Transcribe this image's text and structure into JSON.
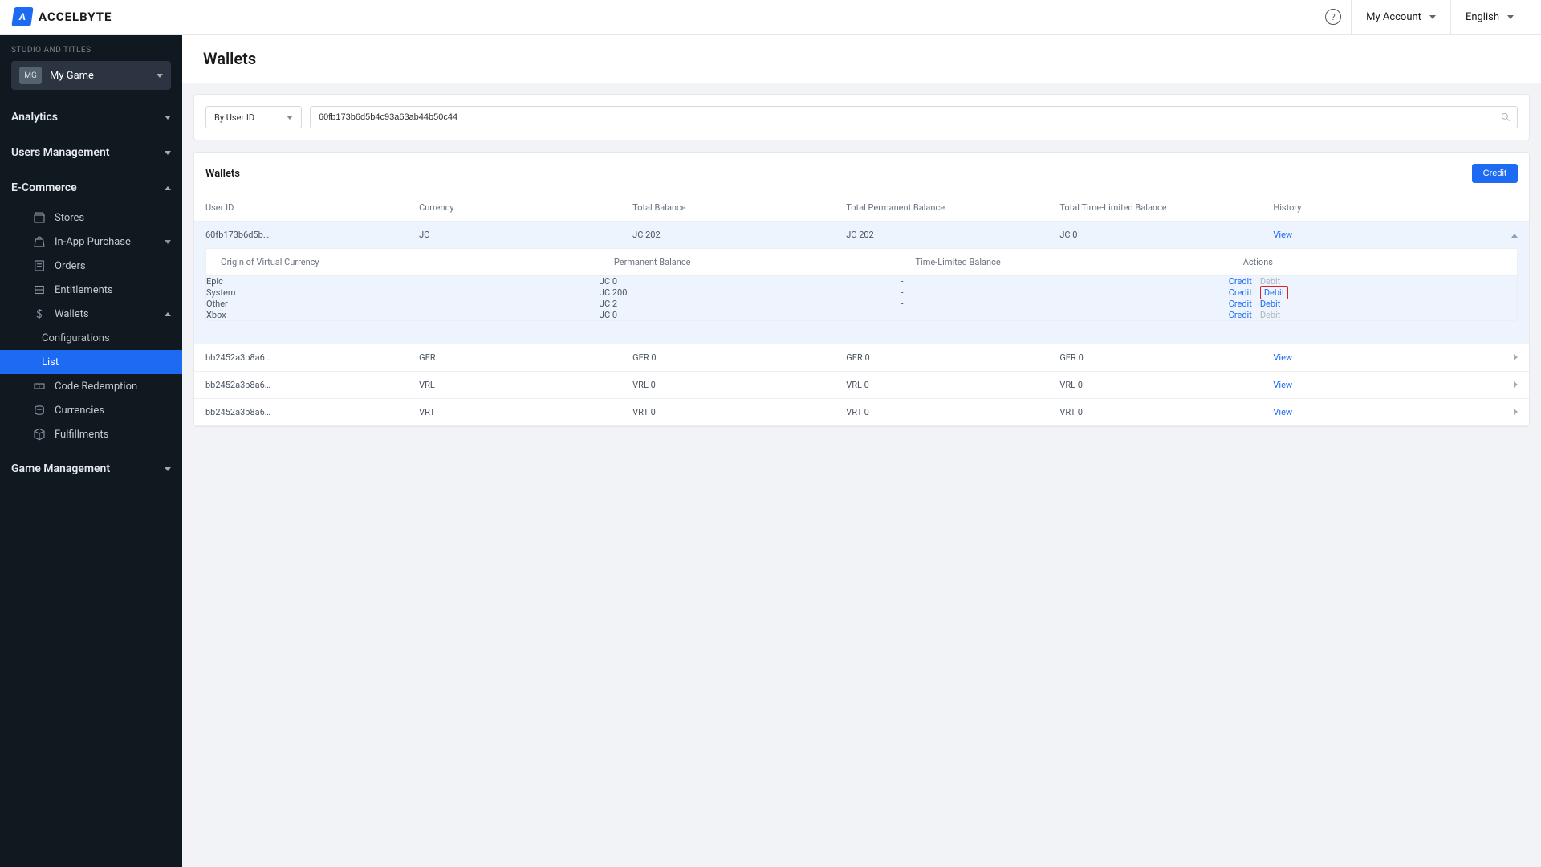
{
  "brand": {
    "name": "ACCELBYTE",
    "mark": "A"
  },
  "header": {
    "account_label": "My Account",
    "language_label": "English"
  },
  "sidebar": {
    "studio_label": "STUDIO AND TITLES",
    "game_badge": "MG",
    "game_name": "My Game",
    "sections": {
      "analytics": "Analytics",
      "users": "Users Management",
      "ecommerce": "E-Commerce",
      "game_mgmt": "Game Management"
    },
    "ecomm_items": {
      "stores": "Stores",
      "iap": "In-App Purchase",
      "orders": "Orders",
      "entitlements": "Entitlements",
      "wallets": "Wallets",
      "wallets_configurations": "Configurations",
      "wallets_list": "List",
      "code_redemption": "Code Redemption",
      "currencies": "Currencies",
      "fulfillments": "Fulfillments"
    }
  },
  "page": {
    "title": "Wallets"
  },
  "search": {
    "filter_label": "By User ID",
    "value": "60fb173b6d5b4c93a63ab44b50c44",
    "placeholder": ""
  },
  "wallets_section": {
    "title": "Wallets",
    "credit_btn": "Credit",
    "columns": {
      "user_id": "User ID",
      "currency": "Currency",
      "total_balance": "Total Balance",
      "total_permanent": "Total Permanent Balance",
      "total_time_limited": "Total Time-Limited Balance",
      "history": "History"
    },
    "view_label": "View",
    "rows": [
      {
        "user_id": "60fb173b6d5b…",
        "currency": "JC",
        "total": "JC 202",
        "perm": "JC 202",
        "time": "JC 0",
        "expanded": true
      },
      {
        "user_id": "bb2452a3b8a6…",
        "currency": "GER",
        "total": "GER 0",
        "perm": "GER 0",
        "time": "GER 0",
        "expanded": false
      },
      {
        "user_id": "bb2452a3b8a6…",
        "currency": "VRL",
        "total": "VRL 0",
        "perm": "VRL 0",
        "time": "VRL 0",
        "expanded": false
      },
      {
        "user_id": "bb2452a3b8a6…",
        "currency": "VRT",
        "total": "VRT 0",
        "perm": "VRT 0",
        "time": "VRT 0",
        "expanded": false
      }
    ]
  },
  "nested": {
    "columns": {
      "origin": "Origin of Virtual Currency",
      "perm": "Permanent Balance",
      "time": "Time-Limited Balance",
      "actions": "Actions"
    },
    "credit_label": "Credit",
    "debit_label": "Debit",
    "rows": [
      {
        "origin": "Epic",
        "perm": "JC 0",
        "time": "-",
        "credit_enabled": true,
        "debit_enabled": false,
        "debit_highlight": false
      },
      {
        "origin": "System",
        "perm": "JC 200",
        "time": "-",
        "credit_enabled": true,
        "debit_enabled": true,
        "debit_highlight": true
      },
      {
        "origin": "Other",
        "perm": "JC 2",
        "time": "-",
        "credit_enabled": true,
        "debit_enabled": true,
        "debit_highlight": false
      },
      {
        "origin": "Xbox",
        "perm": "JC 0",
        "time": "-",
        "credit_enabled": true,
        "debit_enabled": false,
        "debit_highlight": false
      }
    ]
  }
}
